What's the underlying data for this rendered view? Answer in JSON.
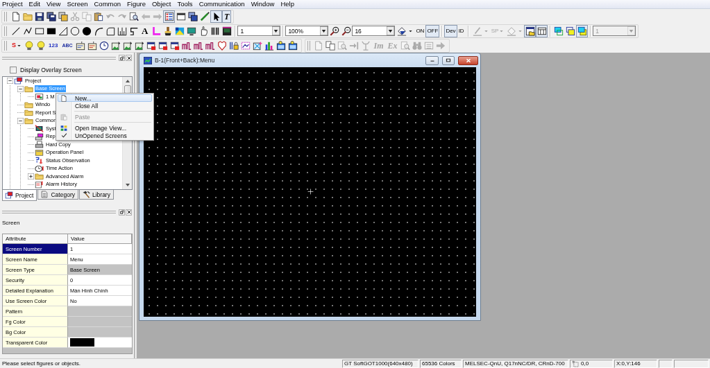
{
  "menu_bar": [
    "Project",
    "Edit",
    "View",
    "Screen",
    "Common",
    "Figure",
    "Object",
    "Tools",
    "Communication",
    "Window",
    "Help"
  ],
  "toolbar_rows": [
    {
      "toolbars": [
        {
          "items": [
            {
              "kind": "icon",
              "pressed": false,
              "disabled": false
            },
            {
              "kind": "icon",
              "pressed": false,
              "disabled": false
            },
            {
              "kind": "icon",
              "pressed": false,
              "disabled": false
            },
            {
              "kind": "icon",
              "pressed": false,
              "disabled": false
            },
            {
              "kind": "icon",
              "pressed": false,
              "disabled": false
            },
            {
              "kind": "icon",
              "pressed": false,
              "disabled": true
            },
            {
              "kind": "icon",
              "pressed": false,
              "disabled": true
            },
            {
              "kind": "icon",
              "pressed": false,
              "disabled": false
            },
            {
              "kind": "icon",
              "pressed": false,
              "disabled": true
            },
            {
              "kind": "icon",
              "pressed": false,
              "disabled": true
            },
            {
              "kind": "icon",
              "pressed": false,
              "disabled": false
            },
            {
              "kind": "icon",
              "pressed": false,
              "disabled": true
            },
            {
              "kind": "icon",
              "pressed": false,
              "disabled": true
            },
            {
              "kind": "icon",
              "pressed": true,
              "disabled": false
            },
            {
              "kind": "icon",
              "pressed": false,
              "disabled": false
            },
            {
              "kind": "icon",
              "pressed": false,
              "disabled": false
            },
            {
              "kind": "icon",
              "pressed": false,
              "disabled": false
            },
            {
              "kind": "icon",
              "pressed": true,
              "disabled": false
            },
            {
              "kind": "text",
              "label": "T",
              "pressed": true,
              "disabled": false
            }
          ]
        }
      ]
    },
    {
      "toolbars": [
        {
          "items": [
            {
              "kind": "icon",
              "pressed": false,
              "disabled": false
            },
            {
              "kind": "icon",
              "pressed": false,
              "disabled": false
            },
            {
              "kind": "icon",
              "pressed": false,
              "disabled": false
            },
            {
              "kind": "icon",
              "pressed": false,
              "disabled": false
            },
            {
              "kind": "icon",
              "pressed": false,
              "disabled": false
            },
            {
              "kind": "icon",
              "pressed": false,
              "disabled": false
            },
            {
              "kind": "icon",
              "pressed": false,
              "disabled": false
            },
            {
              "kind": "icon",
              "pressed": false,
              "disabled": false
            },
            {
              "kind": "icon",
              "pressed": false,
              "disabled": false
            },
            {
              "kind": "icon",
              "pressed": false,
              "disabled": false
            },
            {
              "kind": "icon",
              "pressed": false,
              "disabled": false
            },
            {
              "kind": "text",
              "label": "A",
              "pressed": false,
              "disabled": false
            },
            {
              "kind": "icon",
              "pressed": false,
              "disabled": false
            },
            {
              "kind": "icon",
              "pressed": false,
              "disabled": false
            },
            {
              "kind": "icon",
              "pressed": false,
              "disabled": false
            },
            {
              "kind": "icon",
              "pressed": false,
              "disabled": false
            },
            {
              "kind": "icon",
              "pressed": false,
              "disabled": false
            },
            {
              "kind": "icon",
              "pressed": false,
              "disabled": false
            },
            {
              "kind": "icon",
              "pressed": false,
              "disabled": false
            },
            {
              "kind": "separator"
            },
            {
              "kind": "combo",
              "value": "1",
              "disabled": false
            },
            {
              "kind": "separator"
            },
            {
              "kind": "combo",
              "value": "100%",
              "disabled": false
            },
            {
              "kind": "icon",
              "pressed": false,
              "disabled": false
            },
            {
              "kind": "icon",
              "pressed": false,
              "disabled": false
            },
            {
              "kind": "combo",
              "value": "16",
              "disabled": false
            },
            {
              "kind": "split",
              "disabled": false
            },
            {
              "kind": "text",
              "label": "ON",
              "pressed": false,
              "disabled": false
            },
            {
              "kind": "text",
              "label": "OFF",
              "pressed": true,
              "disabled": false
            },
            {
              "kind": "separator"
            },
            {
              "kind": "text",
              "label": "Dev",
              "pressed": true,
              "disabled": false
            },
            {
              "kind": "text",
              "label": "ID",
              "pressed": false,
              "disabled": false
            },
            {
              "kind": "separator"
            },
            {
              "kind": "split",
              "disabled": true
            },
            {
              "kind": "text_split",
              "label": "SP",
              "disabled": true
            },
            {
              "kind": "split",
              "disabled": true
            },
            {
              "kind": "icon",
              "pressed": true,
              "disabled": false
            },
            {
              "kind": "icon",
              "pressed": true,
              "disabled": false
            },
            {
              "kind": "separator"
            },
            {
              "kind": "icon",
              "pressed": false,
              "disabled": false
            },
            {
              "kind": "icon",
              "pressed": false,
              "disabled": false
            },
            {
              "kind": "icon",
              "pressed": true,
              "disabled": false
            },
            {
              "kind": "separator"
            },
            {
              "kind": "combo",
              "value": "1",
              "disabled": true
            }
          ]
        }
      ]
    },
    {
      "toolbars": [
        {
          "items": [
            {
              "kind": "text_split",
              "label": "S",
              "disabled": false
            },
            {
              "kind": "icon",
              "pressed": false,
              "disabled": false
            },
            {
              "kind": "icon",
              "pressed": false,
              "disabled": false
            },
            {
              "kind": "text",
              "label": "123",
              "pressed": false,
              "disabled": false
            },
            {
              "kind": "text",
              "label": "ABC",
              "pressed": false,
              "disabled": false
            },
            {
              "kind": "icon",
              "pressed": false,
              "disabled": false
            },
            {
              "kind": "icon",
              "pressed": false,
              "disabled": false
            },
            {
              "kind": "icon",
              "pressed": false,
              "disabled": false
            },
            {
              "kind": "icon",
              "pressed": false,
              "disabled": false
            },
            {
              "kind": "icon",
              "pressed": false,
              "disabled": false
            },
            {
              "kind": "icon",
              "pressed": false,
              "disabled": false
            },
            {
              "kind": "icon",
              "pressed": false,
              "disabled": false
            },
            {
              "kind": "icon",
              "pressed": false,
              "disabled": false
            },
            {
              "kind": "icon",
              "pressed": false,
              "disabled": false
            },
            {
              "kind": "icon",
              "pressed": false,
              "disabled": false
            },
            {
              "kind": "icon",
              "pressed": false,
              "disabled": false
            },
            {
              "kind": "icon",
              "pressed": false,
              "disabled": false
            },
            {
              "kind": "icon",
              "pressed": false,
              "disabled": false
            },
            {
              "kind": "icon",
              "pressed": false,
              "disabled": false
            },
            {
              "kind": "icon",
              "pressed": false,
              "disabled": false
            },
            {
              "kind": "icon",
              "pressed": false,
              "disabled": false
            },
            {
              "kind": "icon",
              "pressed": false,
              "disabled": false
            },
            {
              "kind": "icon",
              "pressed": false,
              "disabled": false
            },
            {
              "kind": "icon",
              "pressed": false,
              "disabled": false
            }
          ]
        },
        {
          "items": [
            {
              "kind": "icon",
              "pressed": false,
              "disabled": true
            },
            {
              "kind": "icon",
              "pressed": false,
              "disabled": false
            },
            {
              "kind": "icon",
              "pressed": false,
              "disabled": true
            },
            {
              "kind": "icon",
              "pressed": false,
              "disabled": true
            },
            {
              "kind": "icon",
              "pressed": false,
              "disabled": true
            },
            {
              "kind": "text",
              "label": "Im",
              "pressed": false,
              "disabled": true
            },
            {
              "kind": "text",
              "label": "Ex",
              "pressed": false,
              "disabled": true
            },
            {
              "kind": "icon",
              "pressed": false,
              "disabled": true
            },
            {
              "kind": "icon",
              "pressed": false,
              "disabled": true
            },
            {
              "kind": "icon",
              "pressed": false,
              "disabled": true
            },
            {
              "kind": "icon",
              "pressed": false,
              "disabled": true
            }
          ]
        }
      ]
    }
  ],
  "project_panel": {
    "overlay_checkbox": {
      "label": "Display Overlay Screen",
      "checked": false
    },
    "tree": [
      {
        "label": "Project",
        "kind": "project",
        "expanded": true,
        "selected": false,
        "children": [
          {
            "label": "Base Screen",
            "kind": "folder",
            "expanded": true,
            "selected": true,
            "children": [
              {
                "label": "1 M",
                "kind": "screen",
                "selected": false
              }
            ]
          },
          {
            "label": "Windo",
            "kind": "folder",
            "selected": false
          },
          {
            "label": "Report S",
            "kind": "folder",
            "selected": false
          },
          {
            "label": "Common",
            "kind": "folder",
            "expanded": true,
            "selected": false,
            "children": [
              {
                "label": "Syst",
                "kind": "system",
                "selected": false
              },
              {
                "label": "Rep",
                "kind": "report",
                "selected": false
              },
              {
                "label": "Hard Copy",
                "kind": "hard_copy",
                "selected": false
              },
              {
                "label": "Operation Panel",
                "kind": "operation_panel",
                "selected": false
              },
              {
                "label": "Status Observation",
                "kind": "status_observation",
                "selected": false
              },
              {
                "label": "Time Action",
                "kind": "time_action",
                "selected": false
              },
              {
                "label": "Advanced Alarm",
                "kind": "folder",
                "expanded": false,
                "selected": false
              },
              {
                "label": "Alarm History",
                "kind": "alarm_history",
                "selected": false
              }
            ]
          }
        ]
      }
    ],
    "tabs": [
      {
        "label": "Project",
        "selected": true
      },
      {
        "label": "Category",
        "selected": false
      },
      {
        "label": "Library",
        "selected": false
      }
    ]
  },
  "context_menu": {
    "items": [
      {
        "kind": "item",
        "label": "New...",
        "highlighted": true,
        "disabled": false,
        "checked": false
      },
      {
        "kind": "item",
        "label": "Close All",
        "highlighted": false,
        "disabled": false,
        "checked": false
      },
      {
        "kind": "separator"
      },
      {
        "kind": "item",
        "label": "Paste",
        "highlighted": false,
        "disabled": true,
        "checked": false
      },
      {
        "kind": "separator"
      },
      {
        "kind": "item",
        "label": "Open Image View...",
        "highlighted": false,
        "disabled": false,
        "checked": false
      },
      {
        "kind": "item",
        "label": "UnOpened Screens",
        "highlighted": false,
        "disabled": false,
        "checked": true
      }
    ]
  },
  "properties_panel": {
    "title": "Screen",
    "columns": [
      "Attribute",
      "Value"
    ],
    "rows": [
      {
        "attribute": "Screen Number",
        "kind": "text",
        "value": "1",
        "selected": true
      },
      {
        "attribute": "Screen Name",
        "kind": "text",
        "value": "Menu",
        "selected": false
      },
      {
        "attribute": "Screen Type",
        "kind": "readonly",
        "value": "Base Screen",
        "selected": false
      },
      {
        "attribute": "Security",
        "kind": "text",
        "value": "0",
        "selected": false
      },
      {
        "attribute": "Detailed Explanation",
        "kind": "text",
        "value": "Màn Hình Chính",
        "selected": false
      },
      {
        "attribute": "Use Screen Color",
        "kind": "text",
        "value": "No",
        "selected": false
      },
      {
        "attribute": "Pattern",
        "kind": "readonly",
        "selected": false
      },
      {
        "attribute": "Fg Color",
        "kind": "readonly",
        "selected": false
      },
      {
        "attribute": "Bg Color",
        "kind": "readonly",
        "selected": false
      },
      {
        "attribute": "Transparent Color",
        "kind": "swatch",
        "color": "#000000",
        "selected": false
      }
    ]
  },
  "editor_window": {
    "title": "B-1(Front+Back):Menu"
  },
  "status_bar": {
    "message": "Please select figures or objects.",
    "panels": [
      "GT SoftGOT1000(640x480)",
      "65536 Colors",
      "MELSEC-QnU, Q17nNC/DR, CRnD-700",
      "0,0",
      "X:0,Y:146"
    ]
  }
}
